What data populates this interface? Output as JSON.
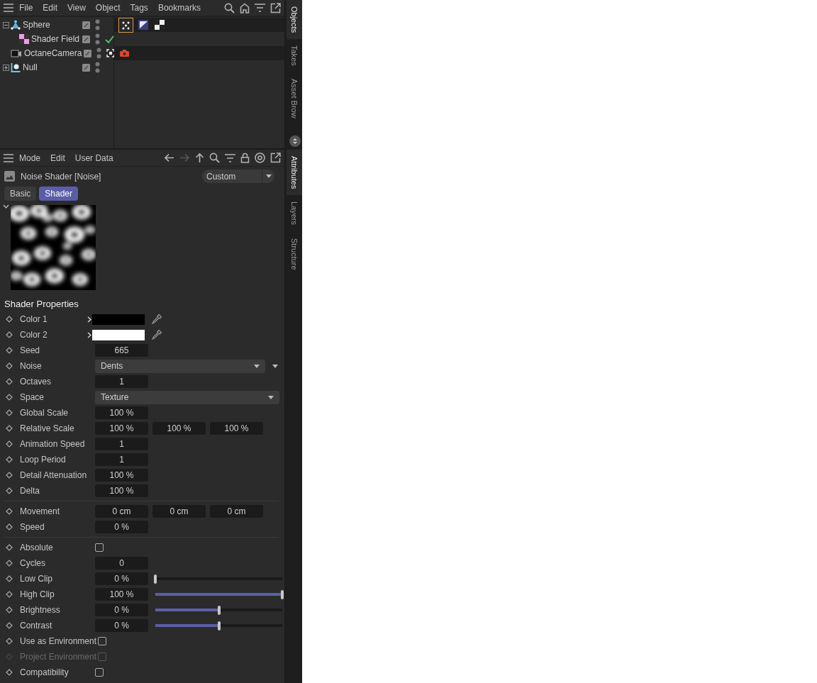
{
  "objects_panel": {
    "menu": [
      "File",
      "Edit",
      "View",
      "Object",
      "Tags",
      "Bookmarks"
    ],
    "objects": [
      {
        "name": "Sphere",
        "kind": "sphere",
        "expanded": true,
        "tags": [
          {
            "kind": "points",
            "selected": true
          },
          {
            "kind": "material",
            "selected": false
          },
          {
            "kind": "checker",
            "selected": false
          }
        ],
        "children": [
          {
            "name": "Shader Field",
            "kind": "shader-field",
            "status": {
              "kind": "check"
            }
          }
        ]
      },
      {
        "name": "OctaneCamera",
        "kind": "camera",
        "status": {
          "kind": "target"
        },
        "tags": [
          {
            "kind": "camera",
            "selected": false
          }
        ]
      },
      {
        "name": "Null",
        "kind": "null",
        "expanded": false
      }
    ]
  },
  "side_tabs_top": [
    {
      "label": "Objects",
      "selected": true
    },
    {
      "label": "Takes",
      "selected": false
    },
    {
      "label": "Asset Brow",
      "selected": false
    }
  ],
  "side_tabs_bottom": [
    {
      "label": "Attributes",
      "selected": true
    },
    {
      "label": "Layers",
      "selected": false
    },
    {
      "label": "Structure",
      "selected": false
    }
  ],
  "attributes_panel": {
    "menu": [
      "Mode",
      "Edit",
      "User Data"
    ],
    "title": "Noise Shader [Noise]",
    "preset": "Custom",
    "tabs": [
      {
        "label": "Basic",
        "selected": false
      },
      {
        "label": "Shader",
        "selected": true
      }
    ],
    "section": "Shader Properties",
    "rows": [
      {
        "kind": "color",
        "label": "Color 1",
        "color": "#000000",
        "disabled": false
      },
      {
        "kind": "color",
        "label": "Color 2",
        "color": "#ffffff",
        "disabled": false
      },
      {
        "kind": "field",
        "label": "Seed",
        "values": [
          "665"
        ],
        "disabled": false
      },
      {
        "kind": "dropdown",
        "label": "Noise",
        "value": "Dents",
        "extra_menu": true,
        "disabled": false
      },
      {
        "kind": "field",
        "label": "Octaves",
        "values": [
          "1"
        ],
        "disabled": false
      },
      {
        "kind": "dropdown",
        "label": "Space",
        "value": "Texture",
        "extra_menu": false,
        "disabled": false
      },
      {
        "kind": "field",
        "label": "Global Scale",
        "values": [
          "100 %"
        ],
        "disabled": false
      },
      {
        "kind": "field",
        "label": "Relative Scale",
        "values": [
          "100 %",
          "100 %",
          "100 %"
        ],
        "disabled": false
      },
      {
        "kind": "field",
        "label": "Animation Speed",
        "values": [
          "1"
        ],
        "disabled": false
      },
      {
        "kind": "field",
        "label": "Loop Period",
        "values": [
          "1"
        ],
        "disabled": false
      },
      {
        "kind": "field",
        "label": "Detail Attenuation",
        "values": [
          "100 %"
        ],
        "disabled": false
      },
      {
        "kind": "field",
        "label": "Delta",
        "values": [
          "100 %"
        ],
        "disabled": false
      },
      {
        "kind": "separator"
      },
      {
        "kind": "field",
        "label": "Movement",
        "values": [
          "0 cm",
          "0 cm",
          "0 cm"
        ],
        "disabled": false
      },
      {
        "kind": "field",
        "label": "Speed",
        "values": [
          "0 %"
        ],
        "disabled": false
      },
      {
        "kind": "separator"
      },
      {
        "kind": "checkbox",
        "label": "Absolute",
        "checked": false,
        "disabled": false
      },
      {
        "kind": "field",
        "label": "Cycles",
        "values": [
          "0"
        ],
        "disabled": false
      },
      {
        "kind": "slider",
        "label": "Low Clip",
        "value": "0 %",
        "level": 0,
        "disabled": false
      },
      {
        "kind": "slider",
        "label": "High Clip",
        "value": "100 %",
        "level": 1,
        "disabled": false
      },
      {
        "kind": "slider",
        "label": "Brightness",
        "value": "0 %",
        "level": 0.5,
        "disabled": false
      },
      {
        "kind": "slider",
        "label": "Contrast",
        "value": "0 %",
        "level": 0.5,
        "disabled": false
      },
      {
        "kind": "checkbox",
        "label": "Use as Environment",
        "checked": false,
        "disabled": false
      },
      {
        "kind": "checkbox",
        "label": "Project Environment",
        "checked": false,
        "disabled": true
      },
      {
        "kind": "checkbox",
        "label": "Compatibility",
        "checked": false,
        "disabled": false
      }
    ]
  }
}
